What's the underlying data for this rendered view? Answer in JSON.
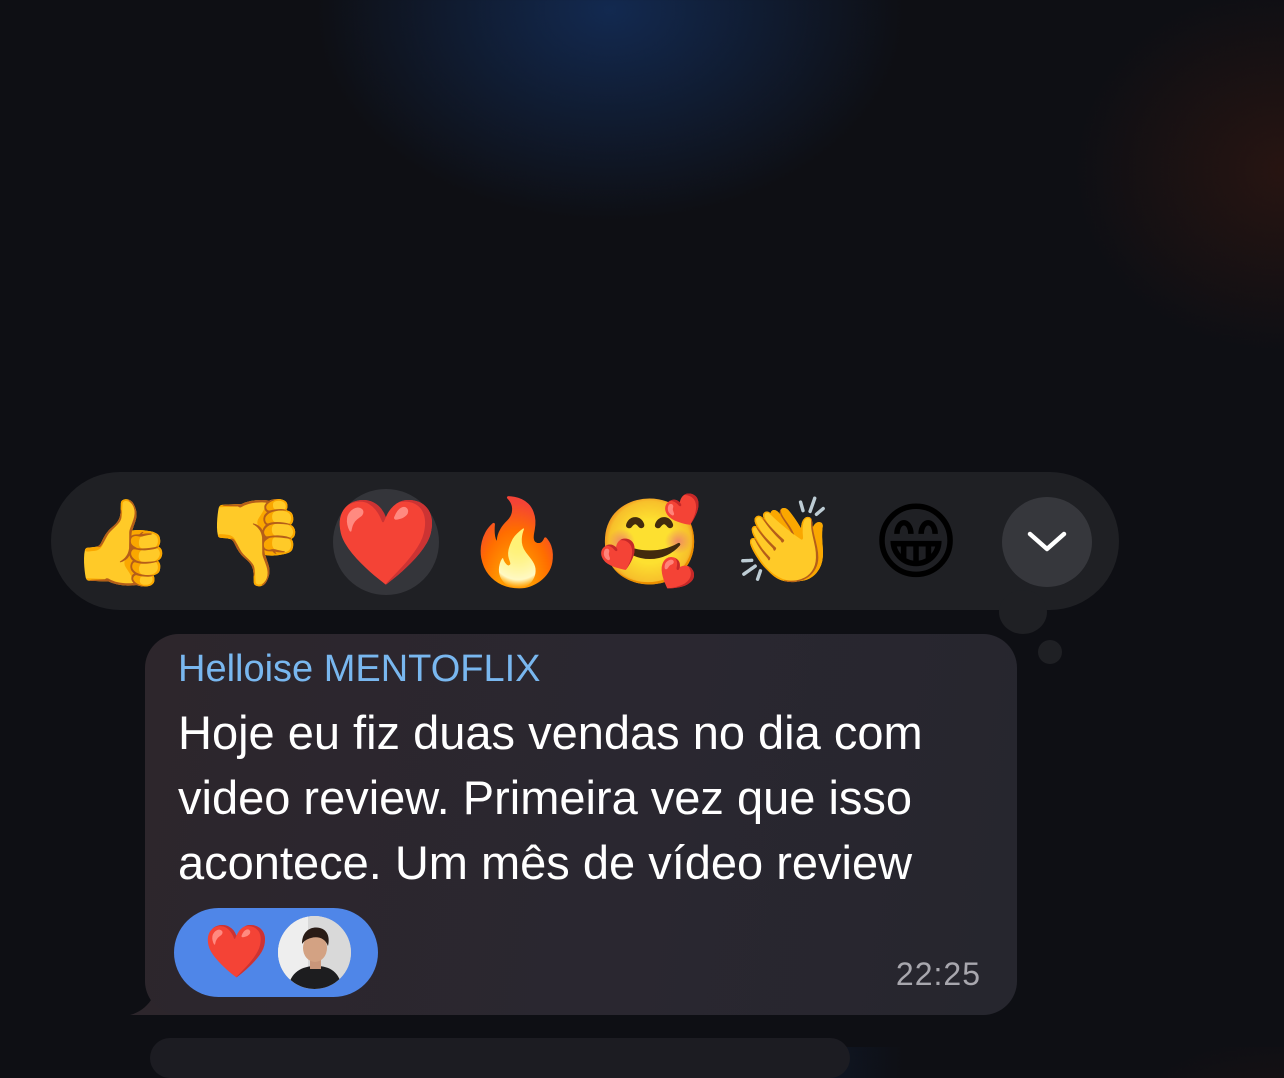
{
  "reaction_bar": {
    "reactions": [
      {
        "name": "thumbs-up",
        "emoji": "👍"
      },
      {
        "name": "thumbs-down",
        "emoji": "👎"
      },
      {
        "name": "red-heart",
        "emoji": "❤️"
      },
      {
        "name": "fire",
        "emoji": "🔥"
      },
      {
        "name": "smiling-face-with-hearts",
        "emoji": "🥰"
      },
      {
        "name": "clapping-hands",
        "emoji": "👏"
      },
      {
        "name": "beaming-face",
        "emoji": "😁"
      }
    ],
    "selected": "red-heart",
    "expand_icon": "chevron-down-icon"
  },
  "message": {
    "sender": "Helloise MENTOFLIX",
    "lines": [
      "Hoje eu fiz duas vendas no dia com",
      "video review. Primeira vez que isso",
      "acontece. Um mês de vídeo review"
    ],
    "reaction_chip": {
      "emoji": "❤️",
      "avatar": "user-avatar"
    },
    "time": "22:25"
  },
  "colors": {
    "background": "#0e0f14",
    "reaction_bar": "#1f2024",
    "bubble": "#2b2730",
    "sender_name": "#79b7ef",
    "reaction_chip": "#4f86e8",
    "timestamp": "#a8a7ae"
  }
}
